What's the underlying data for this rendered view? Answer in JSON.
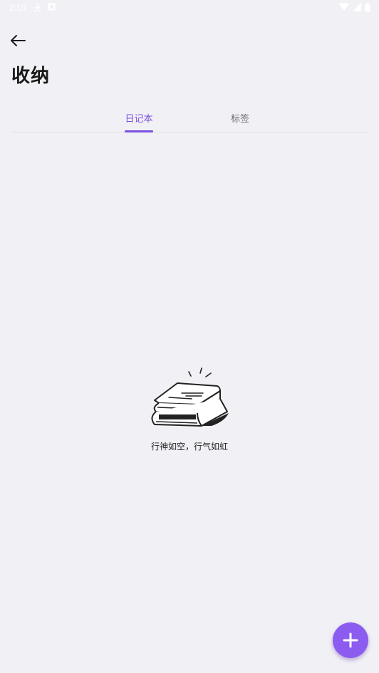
{
  "status_bar": {
    "time": "2:10",
    "icons": [
      "download-icon",
      "notification-icon",
      "wifi-icon",
      "signal-icon",
      "battery-icon"
    ]
  },
  "header": {
    "back_icon": "arrow-left-icon",
    "title": "收纳"
  },
  "tabs": [
    {
      "label": "日记本",
      "active": true
    },
    {
      "label": "标签",
      "active": false
    }
  ],
  "empty_state": {
    "illustration": "books-icon",
    "message": "行神如空，行气如虹"
  },
  "fab": {
    "icon": "plus-icon"
  },
  "colors": {
    "accent": "#7a4fe0",
    "fab": "#8c5cf0",
    "background": "#f1f0f5",
    "inactive_tab": "#6f6c75"
  }
}
